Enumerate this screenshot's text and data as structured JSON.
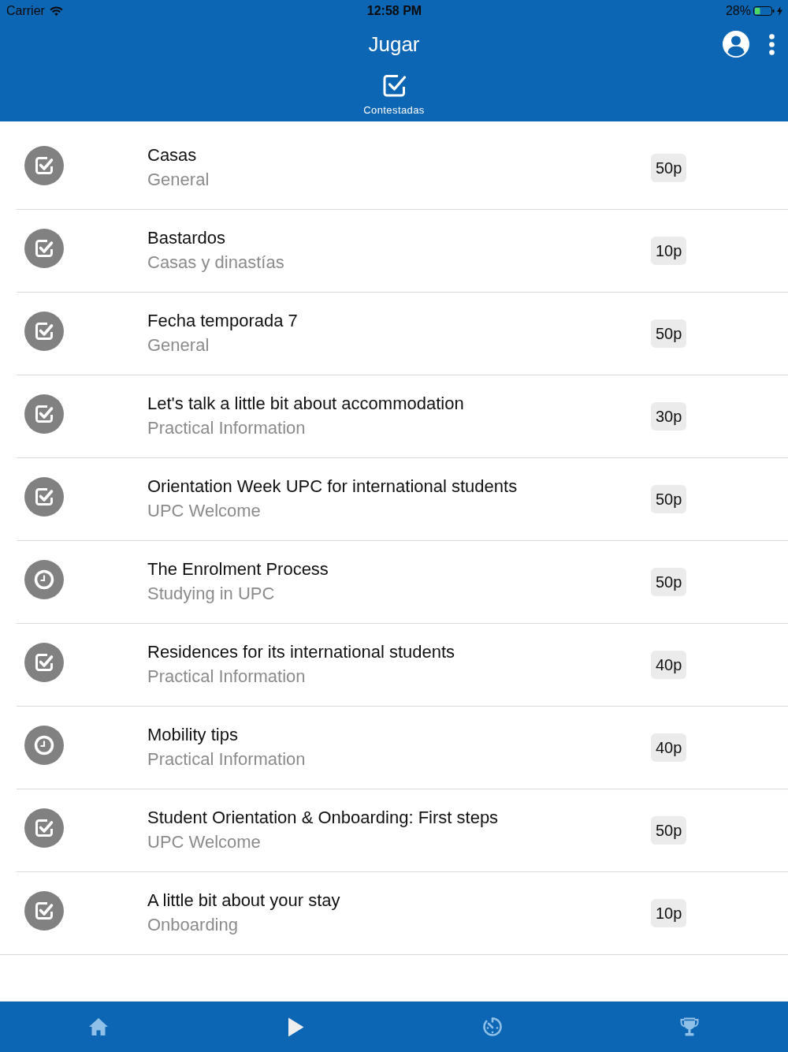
{
  "status_bar": {
    "carrier": "Carrier",
    "time": "12:58 PM",
    "battery": "28%"
  },
  "header": {
    "title": "Jugar"
  },
  "tabs": [
    {
      "label": "Contestadas",
      "selected": true
    }
  ],
  "items": [
    {
      "title": "Casas",
      "category": "General",
      "points": "50p",
      "kind": "answered"
    },
    {
      "title": "Bastardos",
      "category": "Casas y dinastías",
      "points": "10p",
      "kind": "answered"
    },
    {
      "title": "Fecha temporada 7",
      "category": "General",
      "points": "50p",
      "kind": "answered"
    },
    {
      "title": "Let's talk a little bit about accommodation",
      "category": "Practical Information",
      "points": "30p",
      "kind": "answered"
    },
    {
      "title": "Orientation Week UPC for international students",
      "category": "UPC Welcome",
      "points": "50p",
      "kind": "answered"
    },
    {
      "title": "The Enrolment Process",
      "category": "Studying in UPC",
      "points": "50p",
      "kind": "pending"
    },
    {
      "title": "Residences for its international students",
      "category": "Practical Information",
      "points": "40p",
      "kind": "answered"
    },
    {
      "title": "Mobility tips",
      "category": "Practical Information",
      "points": "40p",
      "kind": "pending"
    },
    {
      "title": "Student Orientation & Onboarding: First steps",
      "category": "UPC Welcome",
      "points": "50p",
      "kind": "answered"
    },
    {
      "title": "A little bit about your stay",
      "category": "Onboarding",
      "points": "10p",
      "kind": "answered"
    }
  ],
  "bottom_nav": [
    {
      "kind": "home",
      "selected": false
    },
    {
      "kind": "play",
      "selected": true
    },
    {
      "kind": "timer",
      "selected": false
    },
    {
      "kind": "trophy",
      "selected": false
    }
  ]
}
